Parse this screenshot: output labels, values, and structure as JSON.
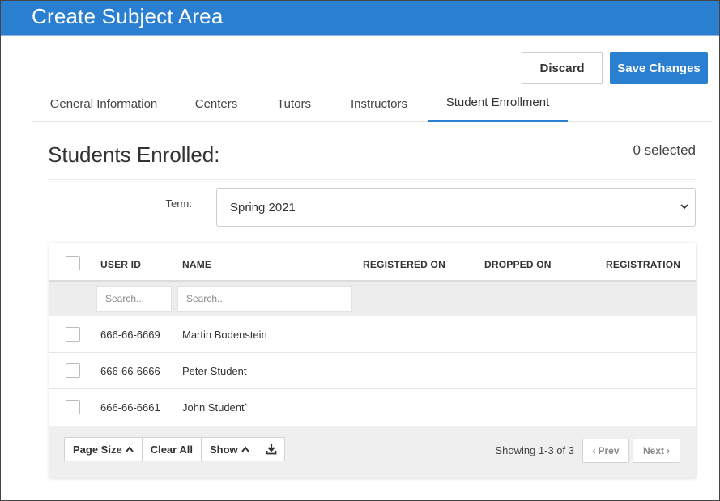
{
  "header": {
    "title": "Create Subject Area"
  },
  "actions": {
    "discard_label": "Discard",
    "save_label": "Save Changes"
  },
  "tabs": [
    {
      "label": "General Information",
      "active": false
    },
    {
      "label": "Centers",
      "active": false
    },
    {
      "label": "Tutors",
      "active": false
    },
    {
      "label": "Instructors",
      "active": false
    },
    {
      "label": "Student Enrollment",
      "active": true
    }
  ],
  "section": {
    "title": "Students Enrolled:",
    "selected_text": "0 selected"
  },
  "term": {
    "label": "Term:",
    "value": "Spring 2021"
  },
  "table": {
    "columns": [
      "USER ID",
      "NAME",
      "REGISTERED ON",
      "DROPPED ON",
      "REGISTRATION"
    ],
    "filters": {
      "user_id_placeholder": "Search...",
      "name_placeholder": "Search..."
    },
    "rows": [
      {
        "user_id": "666-66-6669",
        "name": "Martin Bodenstein"
      },
      {
        "user_id": "666-66-6666",
        "name": "Peter Student"
      },
      {
        "user_id": "666-66-6661",
        "name": "John Student`"
      }
    ]
  },
  "footer": {
    "page_size_label": "Page Size",
    "clear_all_label": "Clear All",
    "show_label": "Show",
    "download_icon": "download-icon",
    "showing_text": "Showing 1-3 of 3",
    "prev_label": "Prev",
    "next_label": "Next"
  },
  "colors": {
    "accent": "#2b7fd1",
    "header_bg": "#2b7fd1"
  }
}
